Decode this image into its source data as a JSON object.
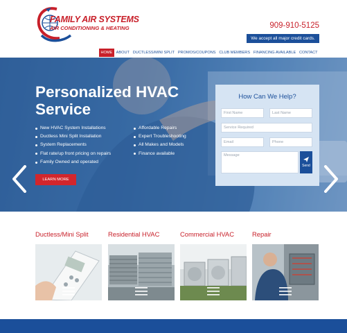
{
  "brand": {
    "name": "FAMILY AIR SYSTEMS",
    "tagline": "AIR CONDITIONING & HEATING",
    "phone": "909-910-5125",
    "payment_badge": "We accept all major credit cards."
  },
  "nav": {
    "items": [
      {
        "label": "HOME",
        "active": true
      },
      {
        "label": "ABOUT"
      },
      {
        "label": "DUCTLESS/MINI SPLIT"
      },
      {
        "label": "PROMOS/COUPONS"
      },
      {
        "label": "CLUB MEMBERS"
      },
      {
        "label": "FINANCING AVAILABLE"
      },
      {
        "label": "CONTACT"
      }
    ]
  },
  "hero": {
    "title": "Personalized HVAC Service",
    "bullets_left": [
      "New HVAC System Installations",
      "Ductless Mini Split Installation",
      "System Replacements",
      "Flat rate/up front pricing on repairs",
      "Family Owned and operated"
    ],
    "bullets_right": [
      "Affordable Repairs",
      "Expert Troubleshooting",
      "All Makes and Models",
      "Finance available"
    ],
    "cta_label": "LEARN MORE",
    "prev_icon": "chevron-left-icon",
    "next_icon": "chevron-right-icon"
  },
  "form": {
    "title": "How Can We Help?",
    "first_name": "First Name",
    "last_name": "Last Name",
    "service": "Service Required",
    "email": "Email",
    "phone": "Phone",
    "message": "Message",
    "send": "Send",
    "send_icon": "paper-plane-icon"
  },
  "services": [
    {
      "title": "Ductless/Mini Split"
    },
    {
      "title": "Residential HVAC"
    },
    {
      "title": "Commercial HVAC"
    },
    {
      "title": "Repair"
    }
  ],
  "colors": {
    "brand_red": "#c8202a",
    "brand_blue": "#1b4f9a",
    "hero_blue": "#3f74ad"
  }
}
